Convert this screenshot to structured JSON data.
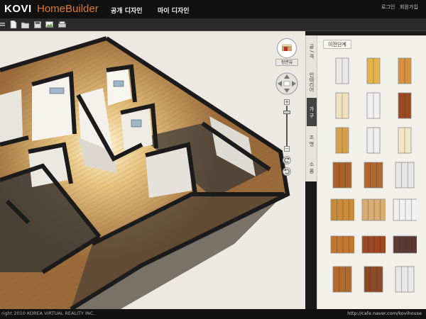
{
  "header": {
    "logo_brand": "KOVI",
    "logo_product": "HomeBuilder",
    "nav": [
      "공개 디자인",
      "마이 디자인"
    ],
    "links": [
      "로그인",
      "회원가입"
    ]
  },
  "toolbar": {
    "icons": [
      "menu-icon",
      "new-file-icon",
      "open-folder-icon",
      "save-icon",
      "image-icon",
      "print-icon"
    ]
  },
  "viewport": {
    "view_label": "정면뷰"
  },
  "side_tabs": [
    "골 / 격",
    "인테리어",
    "가 구",
    "조 명",
    "소 품"
  ],
  "panel": {
    "prev_button": "이전단계",
    "items": [
      {
        "name": "wardrobe-white-tall",
        "color": "#e9e9e9"
      },
      {
        "name": "wardrobe-yellow",
        "color": "#e3b44a"
      },
      {
        "name": "wardrobe-orange",
        "color": "#d69240"
      },
      {
        "name": "wardrobe-cream",
        "color": "#f1e2bf"
      },
      {
        "name": "wardrobe-white",
        "color": "#f0f0f0"
      },
      {
        "name": "wardrobe-brown",
        "color": "#9a4a23"
      },
      {
        "name": "wardrobe-oak",
        "color": "#d4a04c"
      },
      {
        "name": "wardrobe-white-open",
        "color": "#eeeeee"
      },
      {
        "name": "wardrobe-cream-pair",
        "color": "#f2e6c6"
      },
      {
        "name": "wardrobe-narrow-brown",
        "color": "#a9602a"
      },
      {
        "name": "wardrobe-triple-brown",
        "color": "#b0662c"
      },
      {
        "name": "wardrobe-white-wide",
        "color": "#e6e6e6"
      },
      {
        "name": "wardrobe-wide-oak",
        "color": "#c98a3a"
      },
      {
        "name": "wardrobe-wide-light",
        "color": "#d9ad72"
      },
      {
        "name": "wardrobe-wide-white",
        "color": "#f0f0f0"
      },
      {
        "name": "wardrobe-long-oak",
        "color": "#c2762f"
      },
      {
        "name": "wardrobe-long-brown",
        "color": "#9c4622"
      },
      {
        "name": "wardrobe-dark-mix",
        "color": "#5a3a32"
      },
      {
        "name": "wardrobe-small-brown",
        "color": "#b06a2e"
      },
      {
        "name": "wardrobe-small-dark",
        "color": "#8b4a25"
      },
      {
        "name": "wardrobe-small-white",
        "color": "#e8e8e8"
      }
    ]
  },
  "footer": {
    "copyright": "right 2010 KOREA VIRTUAL REALITY INC.",
    "cafe_url": "http://cafe.naver.com/kovihouse"
  },
  "colors": {
    "accent_orange": "#e07a22",
    "floor_wood": "#b8874c",
    "wall_black": "#1b1b1b"
  }
}
